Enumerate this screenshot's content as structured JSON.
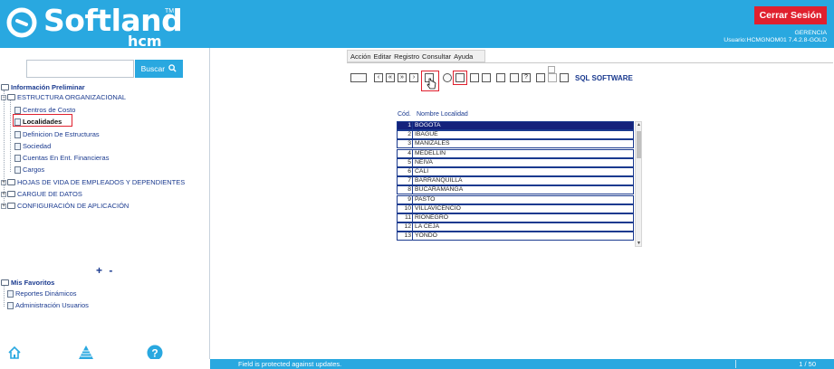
{
  "header": {
    "logo_text": "Softland",
    "logo_tm": "TM",
    "logo_sub": "hcm",
    "logout_label": "Cerrar Sesión",
    "company": "GERENCIA",
    "user": "Usuario:HCMGNOM01 7.4.2.8-GOLD"
  },
  "search": {
    "placeholder": "",
    "button_label": "Buscar"
  },
  "tree": {
    "root": "Información Preliminar",
    "group1": "ESTRUCTURA ORGANIZACIONAL",
    "children": [
      "Centros de Costo",
      "Localidades",
      "Definicion De Estructuras",
      "Sociedad",
      "Cuentas En Ent. Financieras",
      "Cargos"
    ],
    "group2": "HOJAS DE VIDA DE EMPLEADOS Y DEPENDIENTES",
    "group3": "CARGUE DE DATOS",
    "group4": "CONFIGURACIÓN DE APLICACIÓN"
  },
  "favorites": {
    "title": "Mis Favoritos",
    "items": [
      "Reportes Dinámicos",
      "Administración Usuarios"
    ]
  },
  "tree_controls": {
    "plus": "+",
    "minus": "-"
  },
  "app": {
    "menu": [
      "Acción",
      "Editar",
      "Registro",
      "Consultar",
      "Ayuda"
    ],
    "toolbar_label": "SQL SOFTWARE"
  },
  "table": {
    "col_cod": "Cód.",
    "col_nombre": "Nombre Localidad",
    "rows": [
      {
        "cod": "1",
        "name": "BOGOTA"
      },
      {
        "cod": "2",
        "name": "IBAGUE"
      },
      {
        "cod": "3",
        "name": "MANIZALES"
      },
      {
        "cod": "4",
        "name": "MEDELLIN"
      },
      {
        "cod": "5",
        "name": "NEIVA"
      },
      {
        "cod": "6",
        "name": "CALI"
      },
      {
        "cod": "7",
        "name": "BARRANQUILLA"
      },
      {
        "cod": "8",
        "name": "BUCARAMANGA"
      },
      {
        "cod": "9",
        "name": "PASTO"
      },
      {
        "cod": "10",
        "name": "VILLAVICENCIO"
      },
      {
        "cod": "11",
        "name": "RIONEGRO"
      },
      {
        "cod": "12",
        "name": "LA CEJA"
      },
      {
        "cod": "13",
        "name": "YONDO"
      }
    ]
  },
  "status": {
    "message": "Field is protected against updates.",
    "page": "1 / 50"
  },
  "colors": {
    "brand": "#29a8e0",
    "danger": "#e0202e",
    "selected_row": "#14227c",
    "text": "#1a3a8f"
  }
}
